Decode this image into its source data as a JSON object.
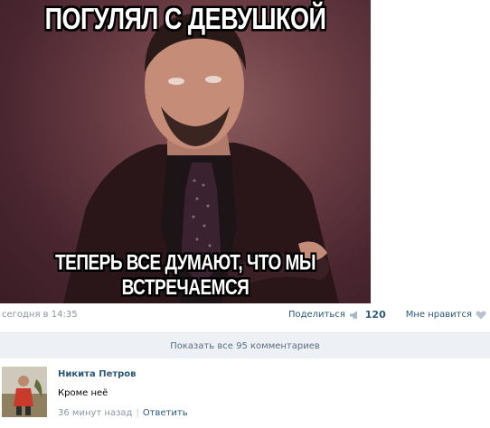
{
  "meme": {
    "top_caption": "ПОГУЛЯЛ С ДЕВУШКОЙ",
    "bottom_caption": "ТЕПЕРЬ ВСЕ ДУМАЮТ, ЧТО МЫ ВСТРЕЧАЕМСЯ"
  },
  "post": {
    "date": "сегодня в 14:35",
    "share_label": "Поделиться",
    "share_count": "120",
    "like_label": "Мне нравится",
    "share_icon": "megaphone-icon",
    "like_icon": "heart-icon"
  },
  "comments_bar": {
    "label": "Показать все 95 комментариев"
  },
  "comment": {
    "author": "Никита Петров",
    "text": "Кроме неё",
    "time": "36 минут назад",
    "separator": "|",
    "reply_label": "Ответить"
  },
  "colors": {
    "link": "#2b587a",
    "muted": "#8a95a5",
    "bar_background": "#edf1f5"
  }
}
